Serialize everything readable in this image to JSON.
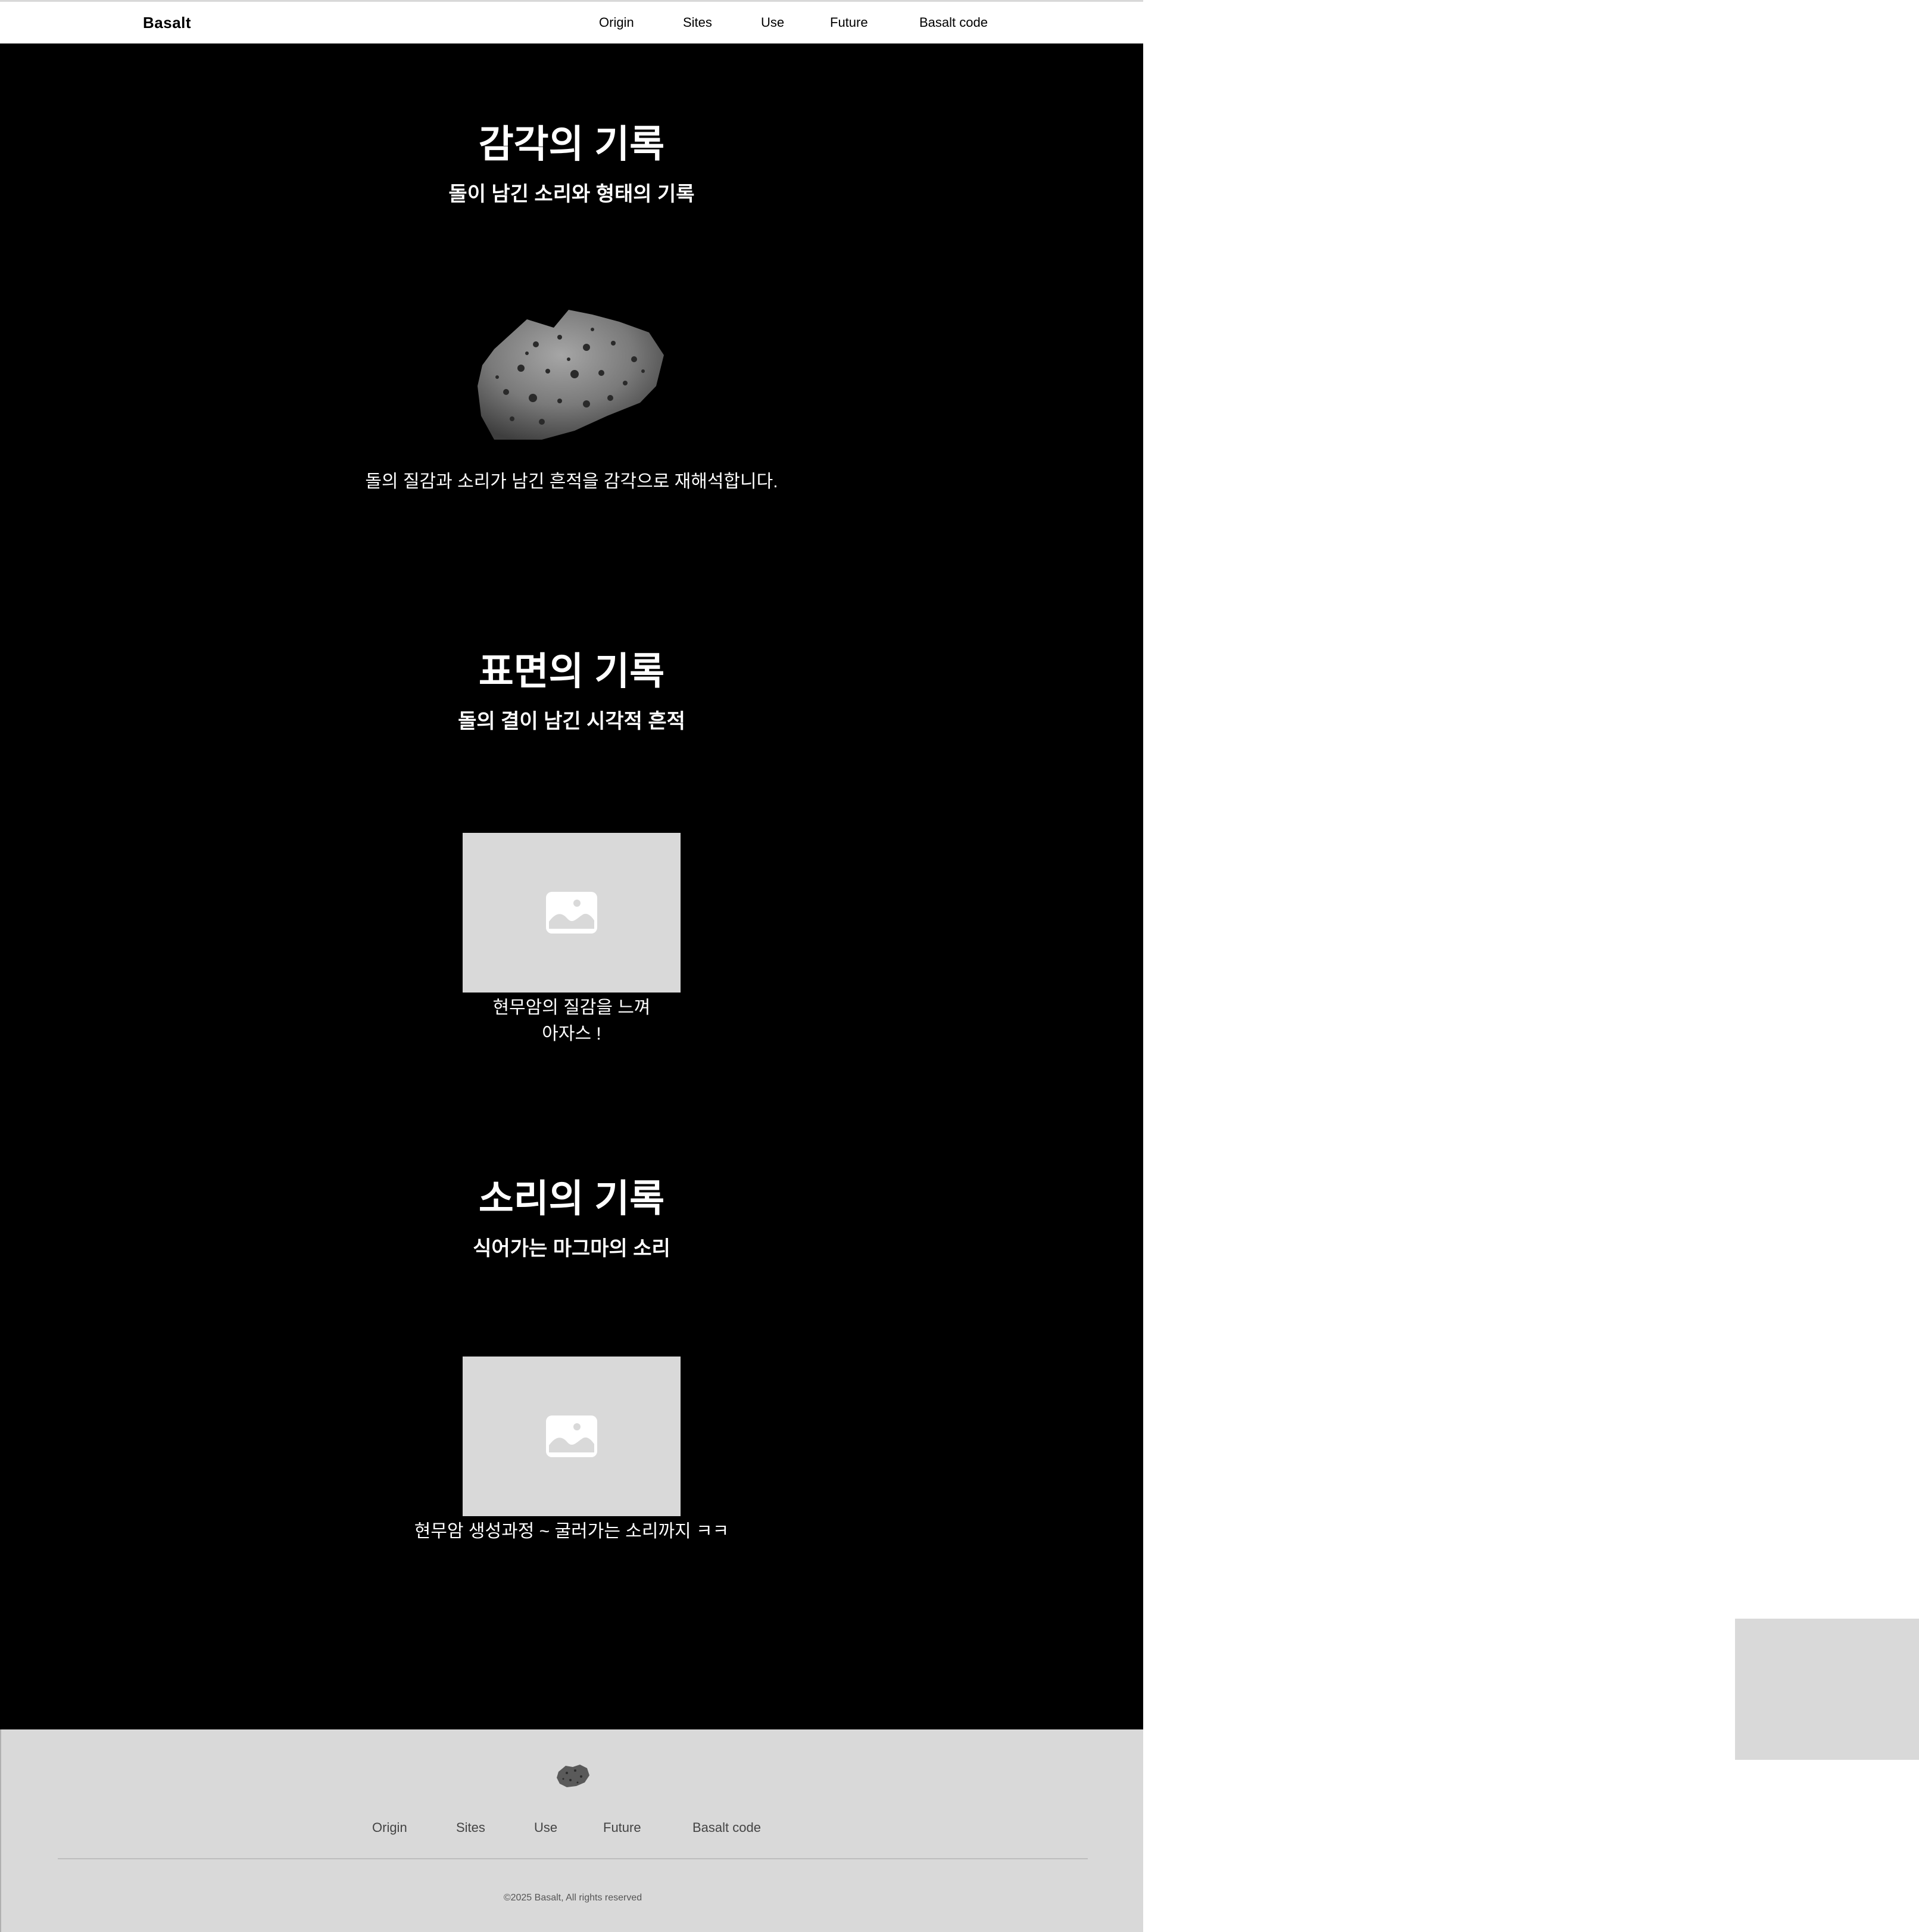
{
  "header": {
    "logo": "Basalt",
    "nav": [
      "Origin",
      "Sites",
      "Use",
      "Future",
      "Basalt code"
    ]
  },
  "sections": [
    {
      "title": "감각의 기록",
      "subtitle": "돌이 남긴 소리와 형태의 기록",
      "image_icon": "basalt-rock-image",
      "caption": "돌의 질감과 소리가 남긴 흔적을 감각으로 재해석합니다."
    },
    {
      "title": "표면의 기록",
      "subtitle": "돌의 결이 남긴 시각적 흔적",
      "image_icon": "image-placeholder-icon",
      "caption_line1": "현무암의 질감을 느껴",
      "caption_line2": "아자스 !"
    },
    {
      "title": "소리의 기록",
      "subtitle": "식어가는 마그마의 소리",
      "image_icon": "image-placeholder-icon",
      "caption": "현무암 생성과정 ~ 굴러가는 소리까지 ㅋㅋ"
    }
  ],
  "footer": {
    "nav": [
      "Origin",
      "Sites",
      "Use",
      "Future",
      "Basalt code"
    ],
    "copyright": "©2025 Basalt, All rights reserved"
  },
  "colors": {
    "main_bg": "#000000",
    "footer_bg": "#d9d9d9",
    "placeholder_bg": "#d9d9d9",
    "text_light": "#ffffff"
  }
}
